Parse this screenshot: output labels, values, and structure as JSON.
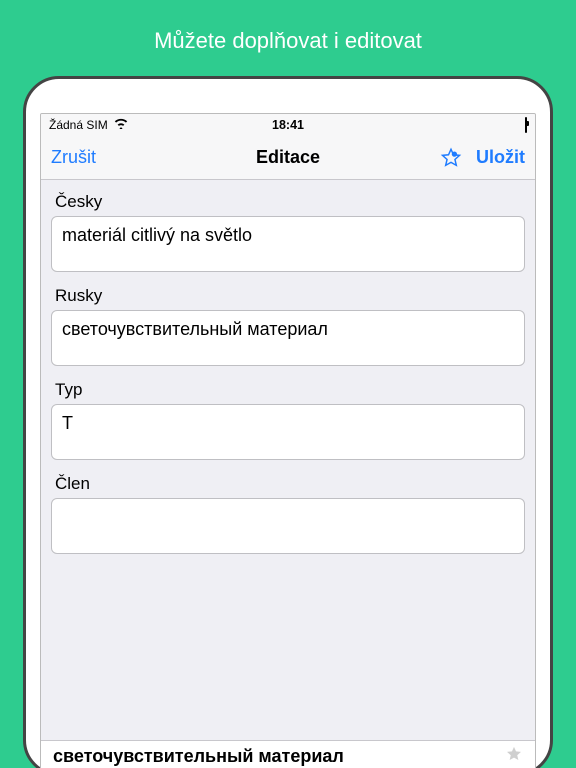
{
  "promo": {
    "headline": "Můžete doplňovat i editovat"
  },
  "status": {
    "carrier": "Žádná SIM",
    "time": "18:41"
  },
  "nav": {
    "cancel": "Zrušit",
    "title": "Editace",
    "save": "Uložit"
  },
  "fields": {
    "czech": {
      "label": "Česky",
      "value": "materiál citlivý na světlo"
    },
    "russian": {
      "label": "Rusky",
      "value": "светочувствительный материал"
    },
    "type": {
      "label": "Typ",
      "value": "T"
    },
    "article": {
      "label": "Člen",
      "value": ""
    }
  },
  "footer": {
    "term": "светочувствительный материал"
  }
}
